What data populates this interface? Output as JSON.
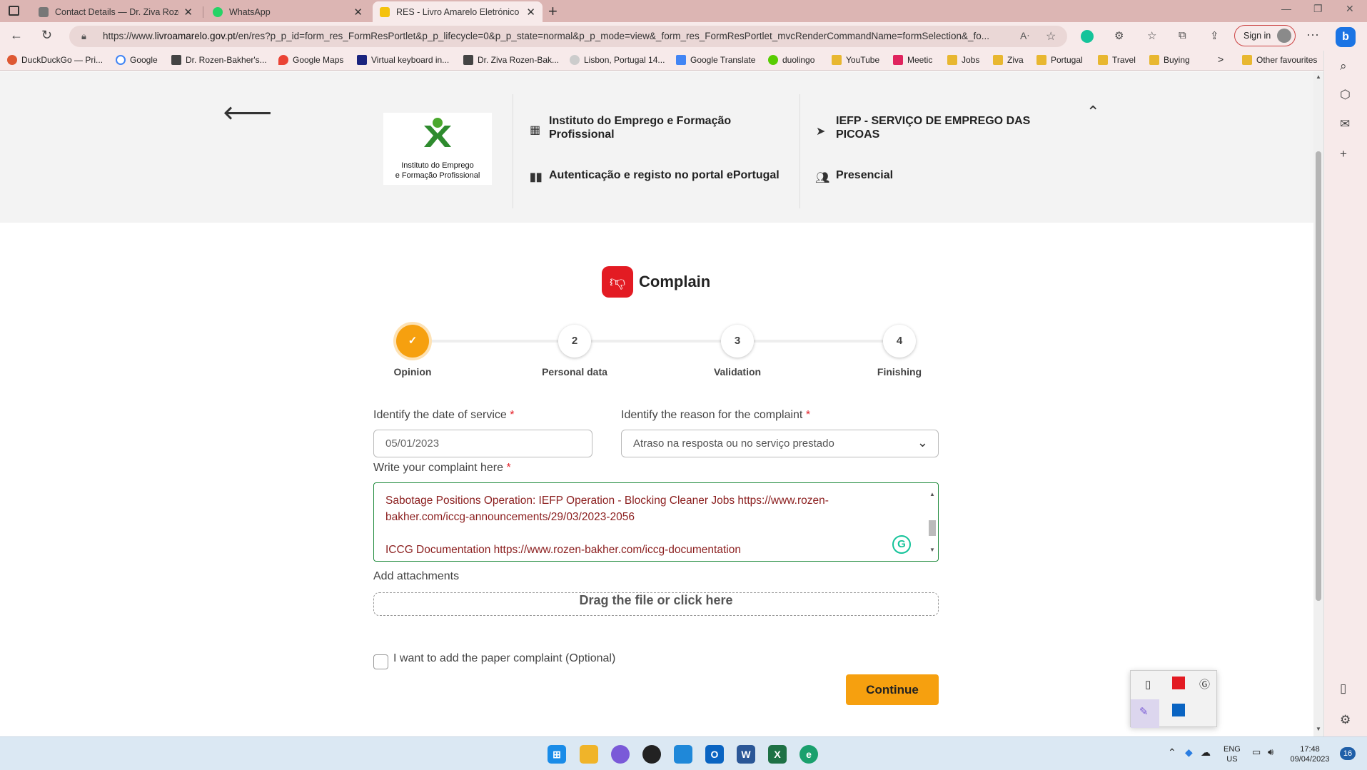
{
  "browser": {
    "tabs": [
      {
        "title": "Contact Details — Dr. Ziva Rozen-",
        "icon": "site-favicon",
        "color": "#777777"
      },
      {
        "title": "WhatsApp",
        "icon": "whatsapp-icon",
        "color": "#25d366"
      },
      {
        "title": "RES - Livro Amarelo Eletrónico",
        "icon": "folder-favicon",
        "color": "#f4c20d",
        "active": true
      }
    ],
    "new_tab": "+",
    "url_prefix": "https://www.",
    "url_domain": "livroamarelo.gov.pt",
    "url_rest": "/en/res?p_p_id=form_res_FormResPortlet&p_p_lifecycle=0&p_p_state=normal&p_p_mode=view&_form_res_FormResPortlet_mvcRenderCommandName=formSelection&_fo...",
    "sign_in": "Sign in",
    "more": "···"
  },
  "bookmarks": [
    {
      "label": "DuckDuckGo — Pri...",
      "icon": "duckduckgo-icon",
      "color": "#de5833"
    },
    {
      "label": "Google",
      "icon": "google-icon",
      "color": "#4285f4"
    },
    {
      "label": "Dr. Rozen-Bakher's...",
      "icon": "cube-icon",
      "color": "#444444"
    },
    {
      "label": "Google Maps",
      "icon": "maps-pin-icon",
      "color": "#ea4335"
    },
    {
      "label": "Virtual keyboard in...",
      "icon": "keyboard-icon",
      "color": "#1a237e"
    },
    {
      "label": "Dr. Ziva Rozen-Bak...",
      "icon": "cube-icon",
      "color": "#444444"
    },
    {
      "label": "Lisbon, Portugal 14...",
      "icon": "weather-icon",
      "color": "#bbbbbb"
    },
    {
      "label": "Google Translate",
      "icon": "translate-icon",
      "color": "#4285f4"
    },
    {
      "label": "duolingo",
      "icon": "duolingo-icon",
      "color": "#58cc02"
    },
    {
      "label": "YouTube",
      "icon": "folder-icon",
      "color": "#e8b730"
    },
    {
      "label": "Meetic",
      "icon": "meetic-icon",
      "color": "#e0245e"
    },
    {
      "label": "Jobs",
      "icon": "folder-icon",
      "color": "#e8b730"
    },
    {
      "label": "Ziva",
      "icon": "folder-icon",
      "color": "#e8b730"
    },
    {
      "label": "Portugal",
      "icon": "folder-icon",
      "color": "#e8b730"
    },
    {
      "label": "Travel",
      "icon": "folder-icon",
      "color": "#e8b730"
    },
    {
      "label": "Buying",
      "icon": "folder-icon",
      "color": "#e8b730"
    }
  ],
  "bookmarks_more": ">",
  "other_favourites": "Other favourites",
  "institution": {
    "logo_line1": "Instituto do Emprego",
    "logo_line2": "e Formação Profissional",
    "name": "Instituto do Emprego e Formação Profissional",
    "auth": "Autenticação e registo no portal ePortugal",
    "service": "IEFP - SERVIÇO DE EMPREGO DAS PICOAS",
    "mode": "Presencial"
  },
  "form": {
    "title": "Complain",
    "steps": [
      {
        "number": "✓",
        "label": "Opinion",
        "done": true
      },
      {
        "number": "2",
        "label": "Personal data",
        "done": false
      },
      {
        "number": "3",
        "label": "Validation",
        "done": false
      },
      {
        "number": "4",
        "label": "Finishing",
        "done": false
      }
    ],
    "date_label": "Identify the date of service",
    "date_value": "05/01/2023",
    "reason_label": "Identify the reason for the complaint",
    "reason_value": "Atraso na resposta ou no serviço prestado",
    "complaint_label": "Write your complaint here",
    "complaint_line1": "Sabotage Positions Operation: IEFP Operation - Blocking Cleaner Jobs https://www.rozen-",
    "complaint_line2": "bakher.com/iccg-announcements/29/03/2023-2056",
    "complaint_line3": "ICCG Documentation https://www.rozen-bakher.com/iccg-documentation",
    "attachments_label": "Add attachments",
    "dropzone": "Drag the file or click here",
    "paper_label": "I want to add the paper complaint (Optional)",
    "continue": "Continue",
    "required_mark": "*"
  },
  "system": {
    "lang1": "ENG",
    "lang2": "US",
    "time": "17:48",
    "date": "09/04/2023",
    "notifications": "16"
  }
}
